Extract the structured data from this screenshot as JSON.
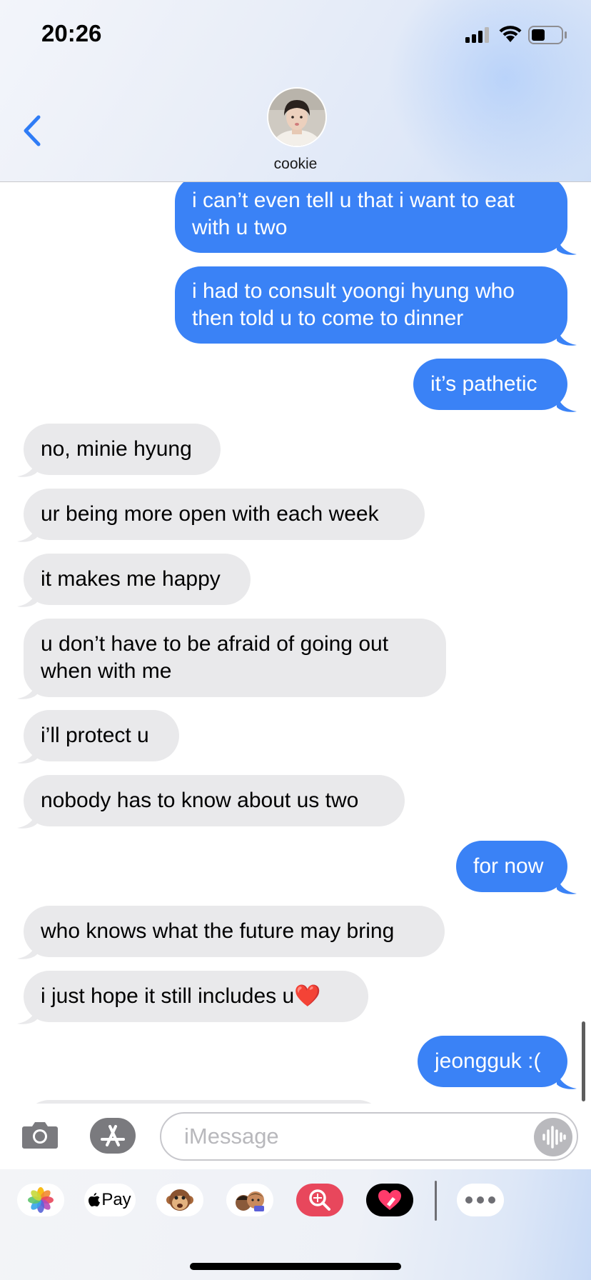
{
  "status_bar": {
    "time": "20:26"
  },
  "header": {
    "contact_name": "cookie"
  },
  "messages": [
    {
      "from": "me",
      "text": "i can’t even tell u that i want to eat with u two"
    },
    {
      "from": "me",
      "text": "i had to consult yoongi hyung who then told u to come to dinner"
    },
    {
      "from": "me",
      "text": "it’s pathetic"
    },
    {
      "from": "them",
      "text": "no, minie hyung"
    },
    {
      "from": "them",
      "text": "ur being more open with each week"
    },
    {
      "from": "them",
      "text": "it makes me happy"
    },
    {
      "from": "them",
      "text": "u don’t have to be afraid of going out when with me"
    },
    {
      "from": "them",
      "text": "i’ll protect u"
    },
    {
      "from": "them",
      "text": "nobody has to know about us two"
    },
    {
      "from": "me",
      "text": "for now"
    },
    {
      "from": "them",
      "text": "who knows what the future may bring"
    },
    {
      "from": "them",
      "text": "i just hope it still includes u❤️"
    },
    {
      "from": "me",
      "text": "jeongguk :("
    }
  ],
  "input": {
    "placeholder": "iMessage"
  },
  "app_drawer": {
    "items": [
      "photos-icon",
      "apple-pay-icon",
      "animoji-icon",
      "memoji-icon",
      "images-search-icon",
      "digital-touch-icon",
      "more-icon"
    ],
    "apple_pay_label": "Pay"
  },
  "colors": {
    "outgoing": "#3a82f6",
    "incoming": "#e9e9eb",
    "accent": "#2f7cf6"
  }
}
